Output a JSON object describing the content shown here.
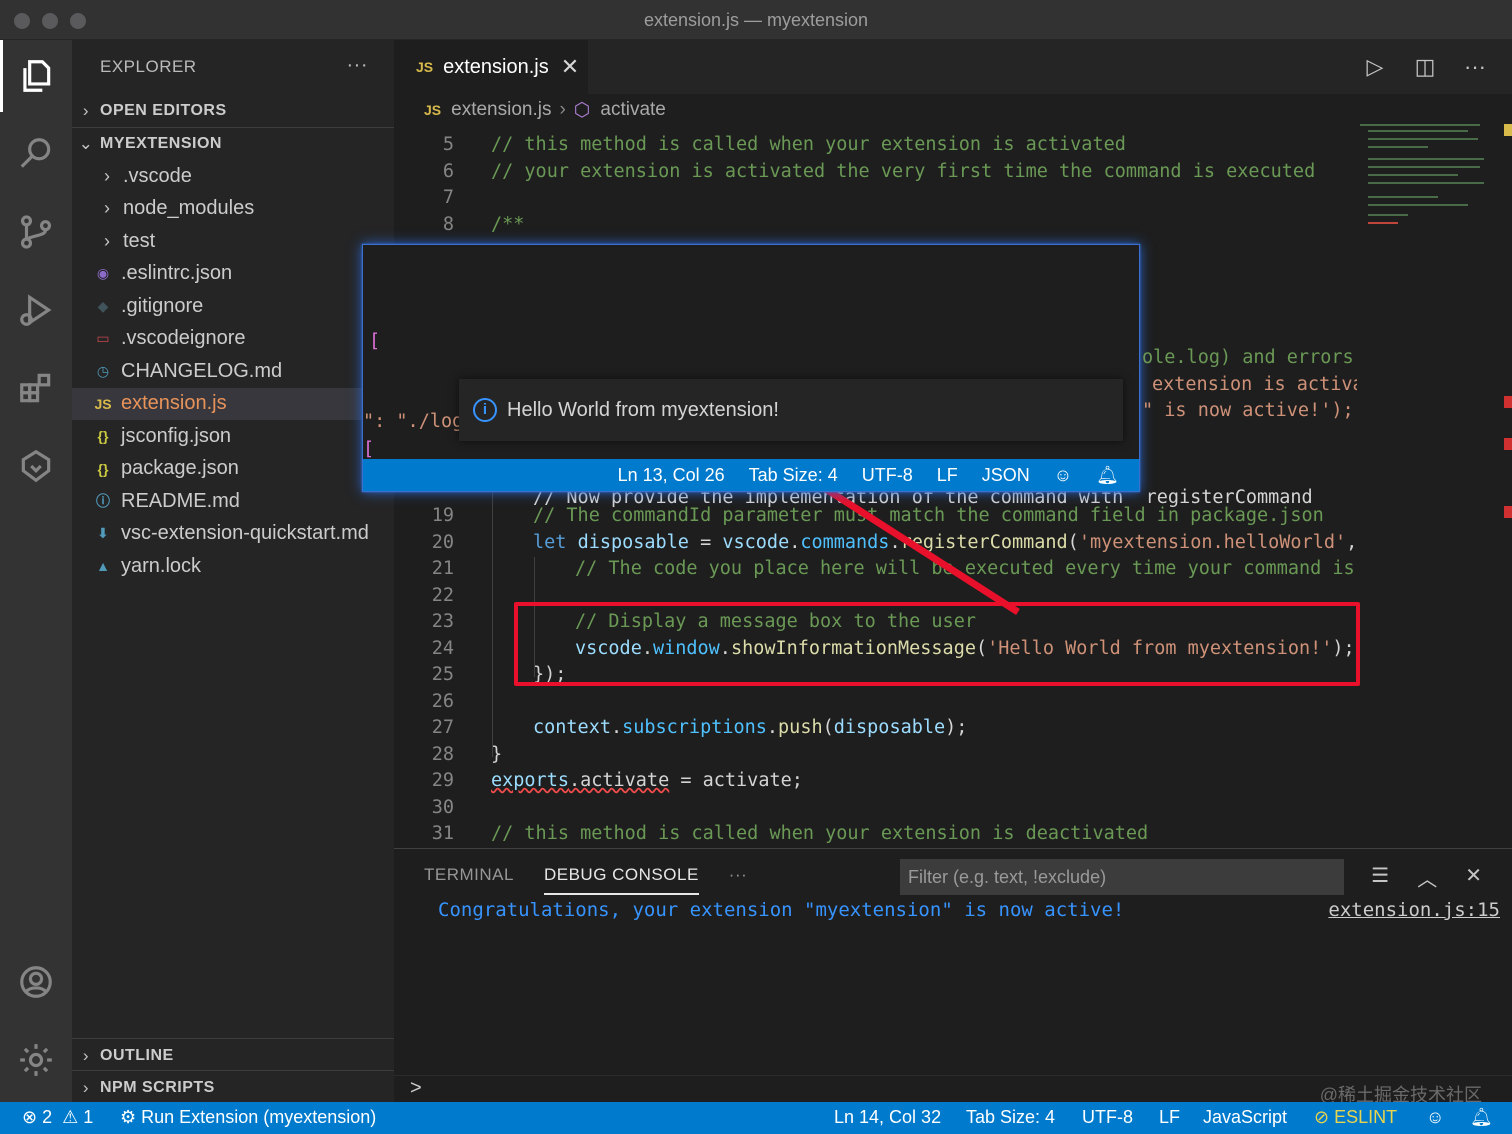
{
  "window": {
    "title": "extension.js — myextension"
  },
  "activity_bar": {
    "items": [
      {
        "name": "explorer-icon"
      },
      {
        "name": "search-icon"
      },
      {
        "name": "source-control-icon"
      },
      {
        "name": "run-debug-icon"
      },
      {
        "name": "extensions-icon"
      },
      {
        "name": "remote-icon"
      },
      {
        "name": "account-icon"
      },
      {
        "name": "settings-gear-icon"
      }
    ]
  },
  "sidebar": {
    "title": "EXPLORER",
    "more": "···",
    "open_editors": "OPEN EDITORS",
    "project": "MYEXTENSION",
    "items": [
      {
        "label": ".vscode",
        "type": "folder",
        "icon": ""
      },
      {
        "label": "node_modules",
        "type": "folder",
        "icon": ""
      },
      {
        "label": "test",
        "type": "folder",
        "icon": ""
      },
      {
        "label": ".eslintrc.json",
        "type": "file",
        "icon": "◉",
        "color": "#8c6bc8"
      },
      {
        "label": ".gitignore",
        "type": "file",
        "icon": "◆",
        "color": "#41535b"
      },
      {
        "label": ".vscodeignore",
        "type": "file",
        "icon": "▭",
        "color": "#c5484e"
      },
      {
        "label": "CHANGELOG.md",
        "type": "file",
        "icon": "◷",
        "color": "#519aba"
      },
      {
        "label": "extension.js",
        "type": "file",
        "icon": "JS",
        "color": "#d7ba4a",
        "selected": true
      },
      {
        "label": "jsconfig.json",
        "type": "file",
        "icon": "{}",
        "color": "#cbcb41"
      },
      {
        "label": "package.json",
        "type": "file",
        "icon": "{}",
        "color": "#cbcb41"
      },
      {
        "label": "README.md",
        "type": "file",
        "icon": "ⓘ",
        "color": "#519aba"
      },
      {
        "label": "vsc-extension-quickstart.md",
        "type": "file",
        "icon": "⬇",
        "color": "#519aba"
      },
      {
        "label": "yarn.lock",
        "type": "file",
        "icon": "▲",
        "color": "#519aba"
      }
    ],
    "outline": "OUTLINE",
    "npm_scripts": "NPM SCRIPTS"
  },
  "editor": {
    "tab_label": "extension.js",
    "js_badge": "JS",
    "breadcrumb": {
      "file": "extension.js",
      "symbol": "activate"
    },
    "lines": [
      {
        "n": "5",
        "text": "// this method is called when your extension is activated"
      },
      {
        "n": "6",
        "text": "// your extension is activated the very first time the command is executed"
      },
      {
        "n": "7",
        "text": ""
      },
      {
        "n": "8",
        "text": "/**"
      },
      {
        "n": "19",
        "text": "// The commandId parameter must match the command field in package.json"
      },
      {
        "n": "20",
        "text": "let disposable = vscode.commands.registerCommand('myextension.helloWorld', fu"
      },
      {
        "n": "21",
        "text": "// The code you place here will be executed every time your command is ex"
      },
      {
        "n": "22",
        "text": ""
      },
      {
        "n": "23",
        "text": "// Display a message box to the user"
      },
      {
        "n": "24",
        "text": "vscode.window.showInformationMessage('Hello World from myextension!');"
      },
      {
        "n": "25",
        "text": "});"
      },
      {
        "n": "26",
        "text": ""
      },
      {
        "n": "27",
        "text": "context.subscriptions.push(disposable);"
      },
      {
        "n": "28",
        "text": "}"
      },
      {
        "n": "29",
        "text": "exports.activate = activate;"
      },
      {
        "n": "30",
        "text": ""
      },
      {
        "n": "31",
        "text": "// this method is called when your extension is deactivated"
      }
    ],
    "partial_18": "// Now provide the implementation of the command with  registerCommand",
    "right_frags": [
      "ole.log) and errors",
      "extension is activa",
      "\" is now active!');"
    ]
  },
  "embedded_window": {
    "left_frag_bracket": "[",
    "left_frag_key": "\": \"./log",
    "left_frag_bracket2": "[",
    "notification": "Hello World from myextension!",
    "status": {
      "position": "Ln 13, Col 26",
      "tab_size": "Tab Size: 4",
      "encoding": "UTF-8",
      "eol": "LF",
      "language": "JSON"
    }
  },
  "panel": {
    "tabs": [
      "TERMINAL",
      "DEBUG CONSOLE"
    ],
    "active_tab": "DEBUG CONSOLE",
    "more": "···",
    "filter_placeholder": "Filter (e.g. text, !exclude)",
    "console_message": "Congratulations, your extension \"myextension\" is now active!",
    "console_source": "extension.js:15",
    "prompt": ">",
    "watermark": "@稀土掘金技术社区"
  },
  "statusbar": {
    "errors": "2",
    "warnings": "1",
    "run": "Run Extension (myextension)",
    "position": "Ln 14, Col 32",
    "tab_size": "Tab Size: 4",
    "encoding": "UTF-8",
    "eol": "LF",
    "language": "JavaScript",
    "eslint": "ESLINT"
  },
  "colors": {
    "accent": "#007acc",
    "highlight": "#e8102a",
    "comment": "#6a9955",
    "string": "#ce9178"
  }
}
